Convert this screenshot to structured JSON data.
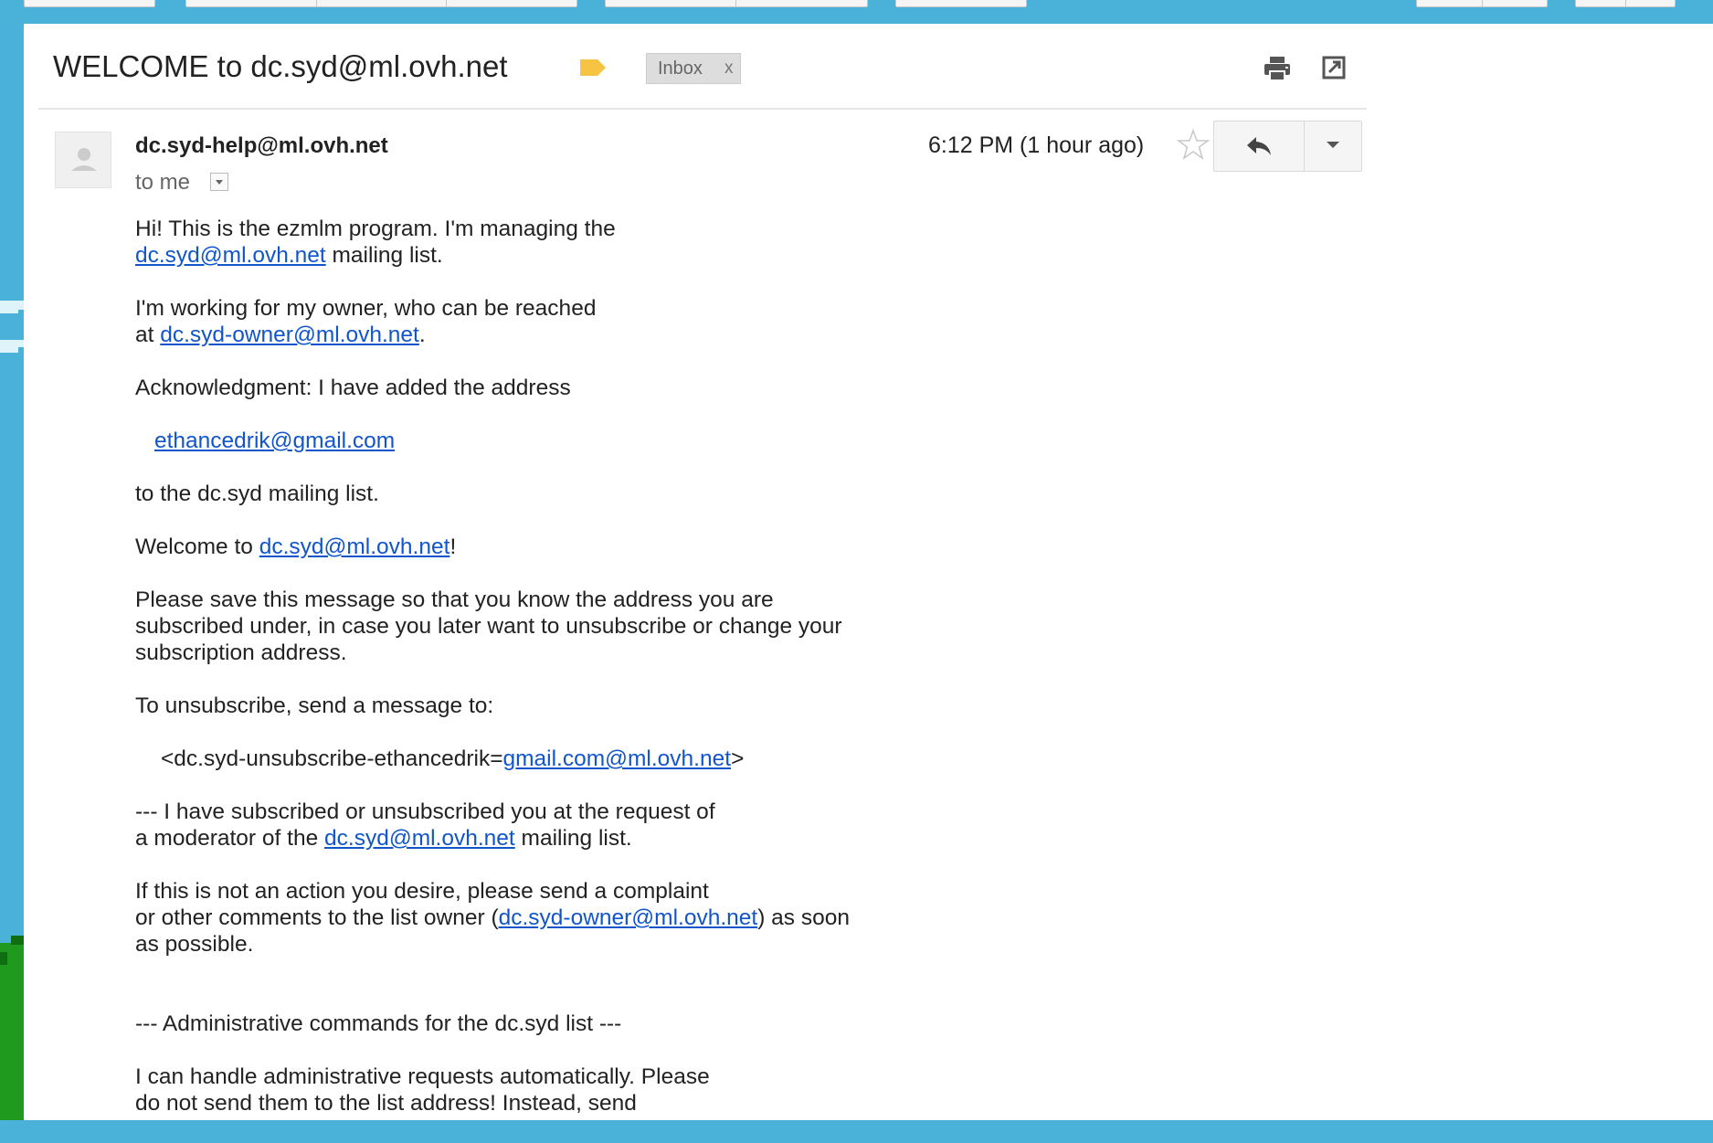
{
  "subject": "WELCOME to dc.syd@ml.ovh.net",
  "inbox_chip": {
    "label": "Inbox",
    "remove": "x"
  },
  "sender": "dc.syd-help@ml.ovh.net",
  "to_me": "to me",
  "timestamp": "6:12 PM (1 hour ago)",
  "icons": {
    "label": "label-icon",
    "print": "print-icon",
    "new_window": "new-window-icon",
    "star": "star-icon",
    "reply": "reply-icon",
    "more": "chevron-down-icon",
    "avatar": "person-icon"
  },
  "colors": {
    "link": "#1155cc",
    "label_tag": "#f6c343",
    "background_sky": "#4ab1d8"
  },
  "body": {
    "p1_text": "Hi! This is the ezmlm program. I'm managing the",
    "p1_link": "dc.syd@ml.ovh.net",
    "p1_tail": " mailing list.",
    "p2_text": "I'm working for my owner, who can be reached",
    "p2_at": "at ",
    "p2_link": "dc.syd-owner@ml.ovh.net",
    "p2_tail": ".",
    "p3_text": "Acknowledgment: I have added the address",
    "p4_link": "ethancedrik@gmail.com",
    "p5_text": "to the dc.syd mailing list.",
    "p6_pre": "Welcome to ",
    "p6_link": "dc.syd@ml.ovh.net",
    "p6_tail": "!",
    "p7_line1": "Please save this message so that you know the address you are",
    "p7_line2": "subscribed under, in case you later want to unsubscribe or change your",
    "p7_line3": "subscription address.",
    "p8_text": "To unsubscribe, send a message to:",
    "p9_pre": "<dc.syd-unsubscribe-ethancedrik=",
    "p9_link": "gmail.com@ml.ovh.net",
    "p9_tail": ">",
    "p10_line1": "--- I have subscribed or unsubscribed you at the request of",
    "p10_pre": "a moderator of the ",
    "p10_link": "dc.syd@ml.ovh.net",
    "p10_tail": " mailing list.",
    "p11_line1": "If this is not an action you desire, please send a complaint",
    "p11_pre": "or other comments to the list owner (",
    "p11_link": "dc.syd-owner@ml.ovh.net",
    "p11_tail": ") as soon",
    "p11_line3": "as possible.",
    "p12_text": "--- Administrative commands for the dc.syd list ---",
    "p13_line1": "I can handle administrative requests automatically. Please",
    "p13_line2": "do not send them to the list address! Instead, send"
  }
}
